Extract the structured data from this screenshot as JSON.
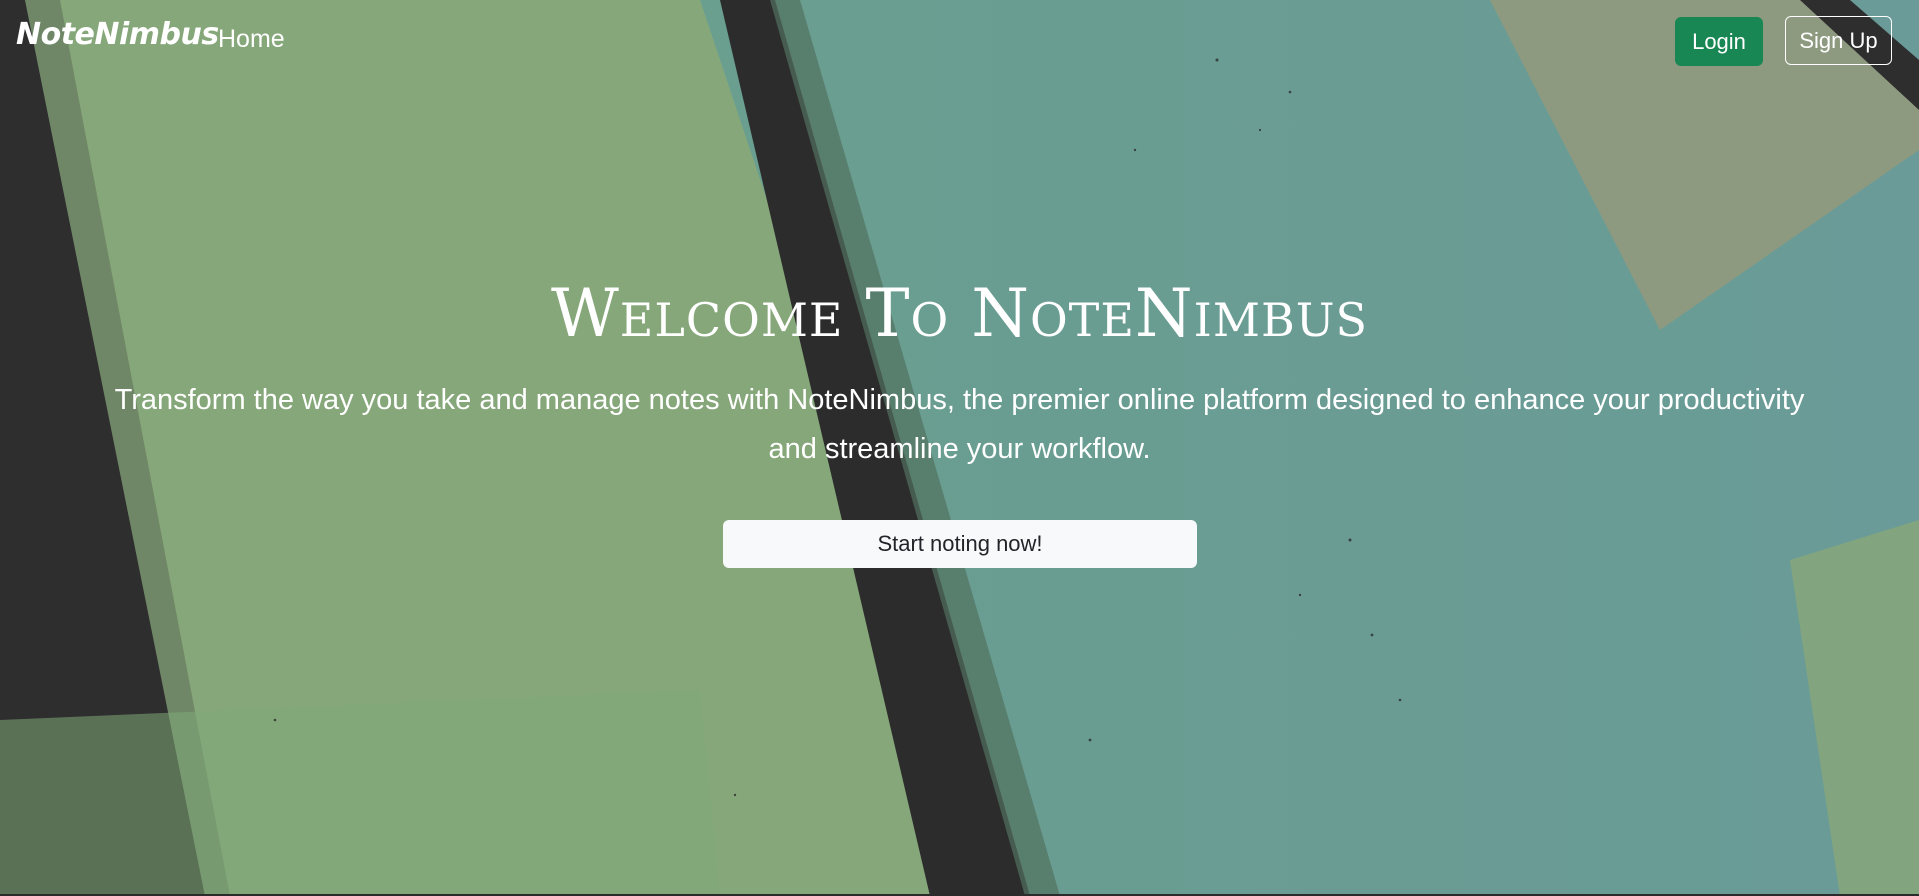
{
  "navbar": {
    "brand": "NoteNimbus",
    "home_label": "Home",
    "login_label": "Login",
    "signup_label": "Sign Up"
  },
  "hero": {
    "title": "Welcome To NoteNimbus",
    "subtitle": "Transform the way you take and manage notes with NoteNimbus, the premier online platform designed to enhance your productivity and streamline your workflow.",
    "cta_label": "Start noting now!"
  },
  "colors": {
    "login_button": "#198754",
    "start_button": "#f8f9fa",
    "green_bg": "#86a77a",
    "teal_bg": "#669e92",
    "brush_dark": "#2c2c2c"
  }
}
